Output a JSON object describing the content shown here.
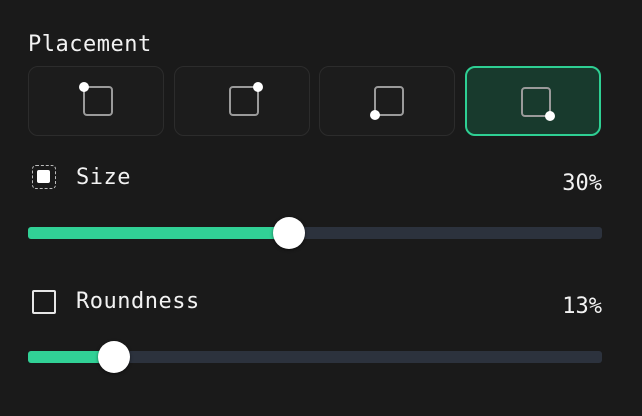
{
  "placement": {
    "label": "Placement",
    "options": [
      {
        "corner": "top-left",
        "active": false
      },
      {
        "corner": "top-right",
        "active": false
      },
      {
        "corner": "bottom-left",
        "active": false
      },
      {
        "corner": "bottom-right",
        "active": true
      }
    ]
  },
  "size": {
    "label": "Size",
    "value_text": "30%",
    "slider_fraction": 0.455
  },
  "roundness": {
    "label": "Roundness",
    "value_text": "13%",
    "slider_fraction": 0.15
  },
  "colors": {
    "background": "#1a1a1a",
    "accent": "#31d196",
    "active_button_bg": "#183a2d",
    "track": "#2c323d"
  }
}
